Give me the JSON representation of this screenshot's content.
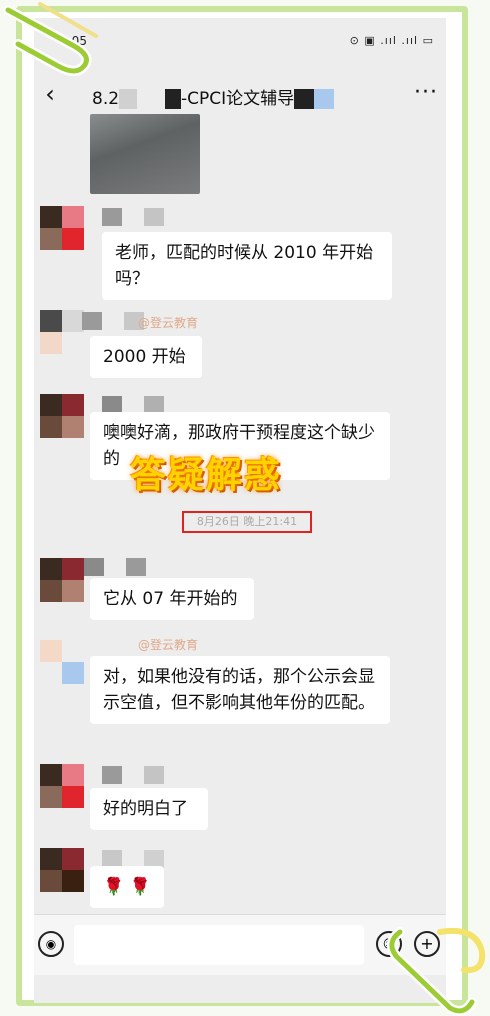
{
  "status_bar": {
    "time": "4:05",
    "icons": "⊙ ▣ .ııl .ııl ▭"
  },
  "nav": {
    "back_icon": "‹",
    "title_prefix": "8.2",
    "title_suffix": "-CPCI论文辅导",
    "more_icon": "···"
  },
  "watermark": "@登云教育",
  "messages": [
    {
      "text": "老师，匹配的时候从 2010 年开始吗？"
    },
    {
      "text": "2000 开始"
    },
    {
      "text": "噢噢好滴，那政府干预程度这个缺少的"
    },
    {
      "text": "它从 07 年开始的"
    },
    {
      "text": "对，如果他没有的话，那个公示会显示空值，但不影响其他年份的匹配。"
    },
    {
      "text": "好的明白了"
    },
    {
      "text": "🌹 🌹"
    }
  ],
  "timestamp": "8月26日 晚上21:41",
  "overlay_text": "答疑解惑",
  "colors": {
    "frame": "#c9e49b",
    "highlight_border": "#e02222",
    "overlay": "#ffd200",
    "clip": "#9ccc34"
  }
}
